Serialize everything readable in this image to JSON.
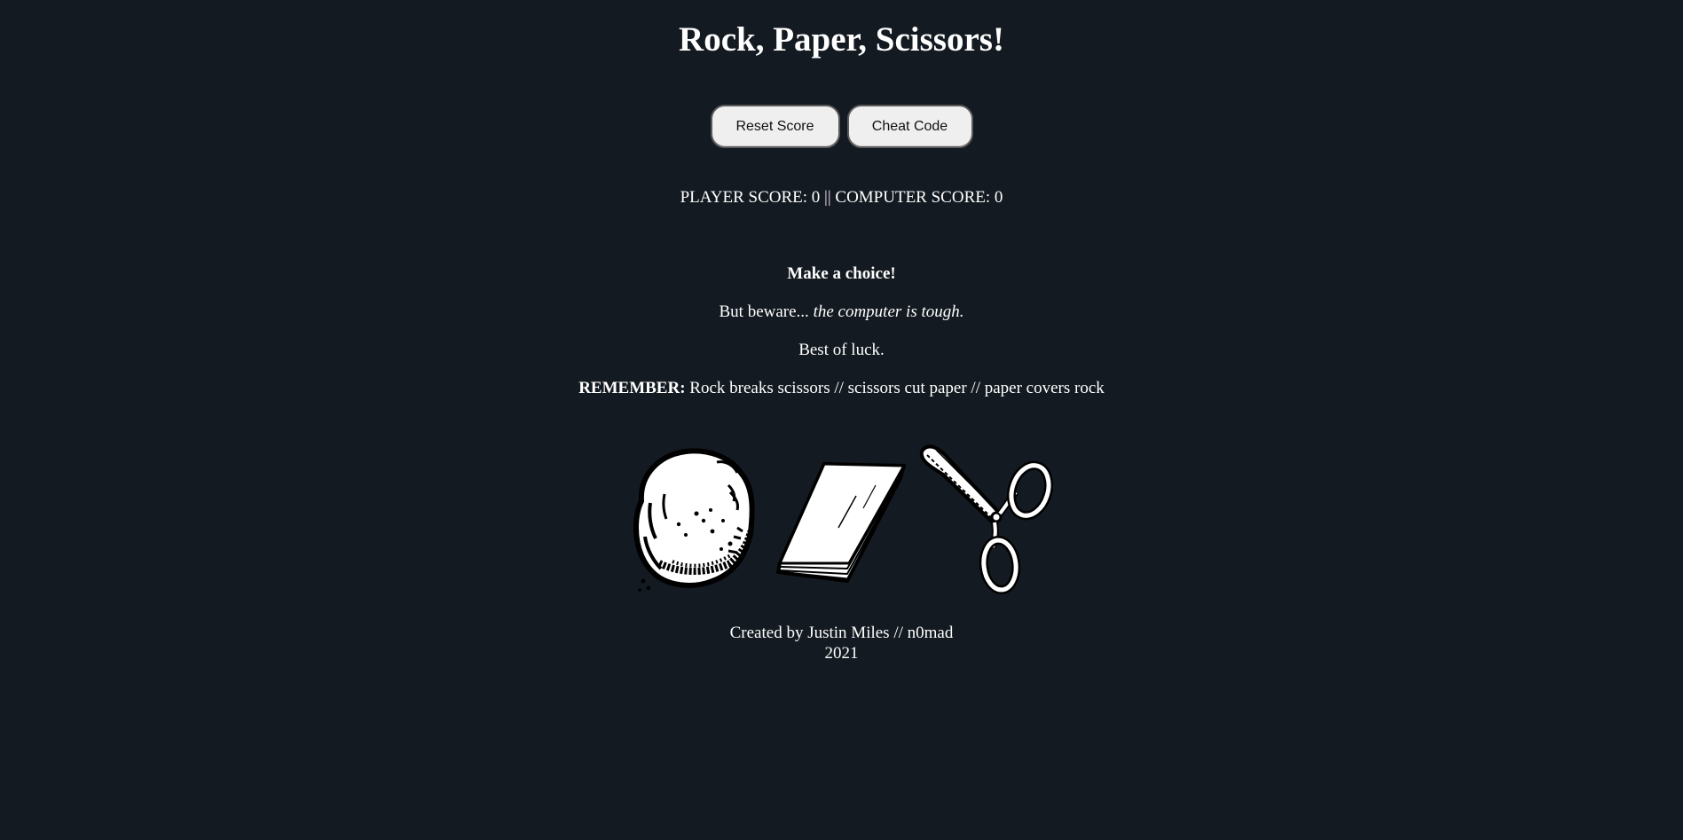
{
  "header": {
    "title": "Rock, Paper, Scissors!"
  },
  "controls": {
    "reset_label": "Reset Score",
    "cheat_label": "Cheat Code"
  },
  "score": {
    "player_label": "PLAYER SCORE:",
    "player_value": "0",
    "separator": "||",
    "computer_label": "COMPUTER SCORE:",
    "computer_value": "0"
  },
  "intro": {
    "prompt": "Make a choice!",
    "beware_prefix": "But beware...",
    "beware_emphasis": "the computer is tough.",
    "luck": "Best of luck.",
    "remember_label": "REMEMBER:",
    "remember_text": "Rock breaks scissors // scissors cut paper // paper covers rock"
  },
  "choices": [
    {
      "id": "rock",
      "icon": "rock-icon"
    },
    {
      "id": "paper",
      "icon": "paper-icon"
    },
    {
      "id": "scissors",
      "icon": "scissors-icon"
    }
  ],
  "footer": {
    "credit": "Created by Justin Miles // n0mad",
    "year": "2021"
  },
  "colors": {
    "background": "#131a21",
    "text": "#ffffff",
    "button_bg": "#efefef"
  }
}
